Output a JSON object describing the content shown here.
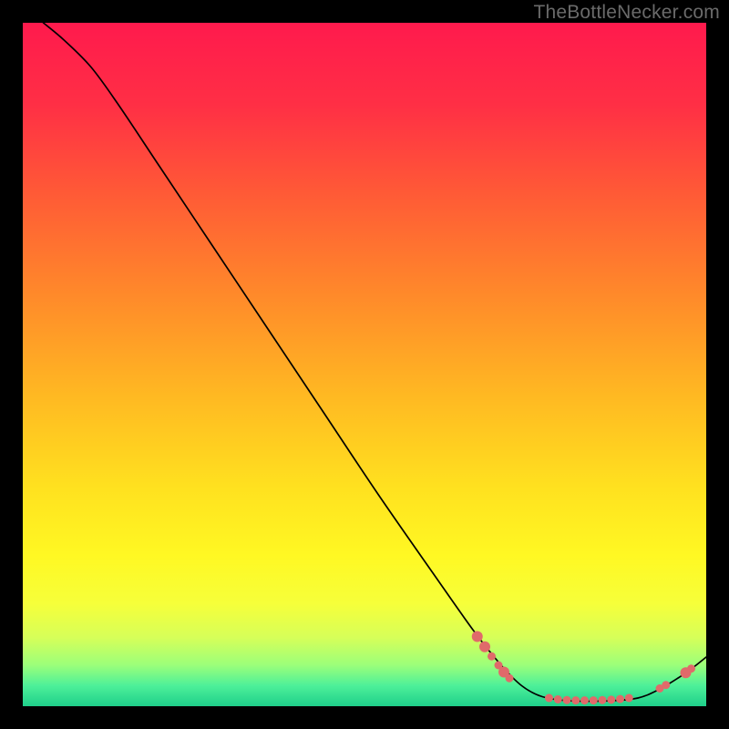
{
  "watermark": "TheBottleNecker.com",
  "chart_data": {
    "type": "line",
    "title": "",
    "xlabel": "",
    "ylabel": "",
    "xlim": [
      0,
      100
    ],
    "ylim": [
      0,
      100
    ],
    "background_gradient": {
      "stops": [
        {
          "offset": 0.0,
          "color": "#ff1a4d"
        },
        {
          "offset": 0.12,
          "color": "#ff2f45"
        },
        {
          "offset": 0.25,
          "color": "#ff5a36"
        },
        {
          "offset": 0.4,
          "color": "#ff8a2a"
        },
        {
          "offset": 0.55,
          "color": "#ffba22"
        },
        {
          "offset": 0.68,
          "color": "#ffe11f"
        },
        {
          "offset": 0.78,
          "color": "#fff823"
        },
        {
          "offset": 0.85,
          "color": "#f6ff3a"
        },
        {
          "offset": 0.9,
          "color": "#d6ff59"
        },
        {
          "offset": 0.94,
          "color": "#9bff7a"
        },
        {
          "offset": 0.97,
          "color": "#4df099"
        },
        {
          "offset": 1.0,
          "color": "#1fcf8a"
        }
      ]
    },
    "series": [
      {
        "name": "curve",
        "color": "#000000",
        "width": 1.7,
        "points": [
          {
            "x": 3.0,
            "y": 100.0
          },
          {
            "x": 6.0,
            "y": 97.5
          },
          {
            "x": 10.0,
            "y": 93.5
          },
          {
            "x": 14.0,
            "y": 88.0
          },
          {
            "x": 20.0,
            "y": 79.0
          },
          {
            "x": 28.0,
            "y": 67.0
          },
          {
            "x": 36.0,
            "y": 55.0
          },
          {
            "x": 44.0,
            "y": 43.0
          },
          {
            "x": 52.0,
            "y": 31.0
          },
          {
            "x": 60.0,
            "y": 19.5
          },
          {
            "x": 66.0,
            "y": 11.0
          },
          {
            "x": 70.0,
            "y": 6.0
          },
          {
            "x": 73.0,
            "y": 3.0
          },
          {
            "x": 76.0,
            "y": 1.4
          },
          {
            "x": 80.0,
            "y": 0.8
          },
          {
            "x": 86.0,
            "y": 0.8
          },
          {
            "x": 90.0,
            "y": 1.2
          },
          {
            "x": 93.0,
            "y": 2.4
          },
          {
            "x": 96.0,
            "y": 4.2
          },
          {
            "x": 98.0,
            "y": 5.6
          },
          {
            "x": 100.0,
            "y": 7.2
          }
        ]
      }
    ],
    "markers": {
      "color": "#e06a6a",
      "radius_small": 4.5,
      "radius_large": 6.0,
      "points": [
        {
          "x": 66.5,
          "y": 10.2,
          "r": "l"
        },
        {
          "x": 67.6,
          "y": 8.7,
          "r": "l"
        },
        {
          "x": 68.6,
          "y": 7.3,
          "r": "s"
        },
        {
          "x": 69.6,
          "y": 6.0,
          "r": "s"
        },
        {
          "x": 70.4,
          "y": 5.0,
          "r": "l"
        },
        {
          "x": 71.2,
          "y": 4.1,
          "r": "s"
        },
        {
          "x": 77.0,
          "y": 1.2,
          "r": "s"
        },
        {
          "x": 78.3,
          "y": 1.0,
          "r": "s"
        },
        {
          "x": 79.6,
          "y": 0.9,
          "r": "s"
        },
        {
          "x": 80.9,
          "y": 0.85,
          "r": "s"
        },
        {
          "x": 82.2,
          "y": 0.85,
          "r": "s"
        },
        {
          "x": 83.5,
          "y": 0.85,
          "r": "s"
        },
        {
          "x": 84.8,
          "y": 0.9,
          "r": "s"
        },
        {
          "x": 86.1,
          "y": 0.95,
          "r": "s"
        },
        {
          "x": 87.4,
          "y": 1.05,
          "r": "s"
        },
        {
          "x": 88.7,
          "y": 1.2,
          "r": "s"
        },
        {
          "x": 93.2,
          "y": 2.6,
          "r": "s"
        },
        {
          "x": 94.1,
          "y": 3.1,
          "r": "s"
        },
        {
          "x": 97.0,
          "y": 4.9,
          "r": "l"
        },
        {
          "x": 97.8,
          "y": 5.5,
          "r": "s"
        }
      ]
    }
  }
}
